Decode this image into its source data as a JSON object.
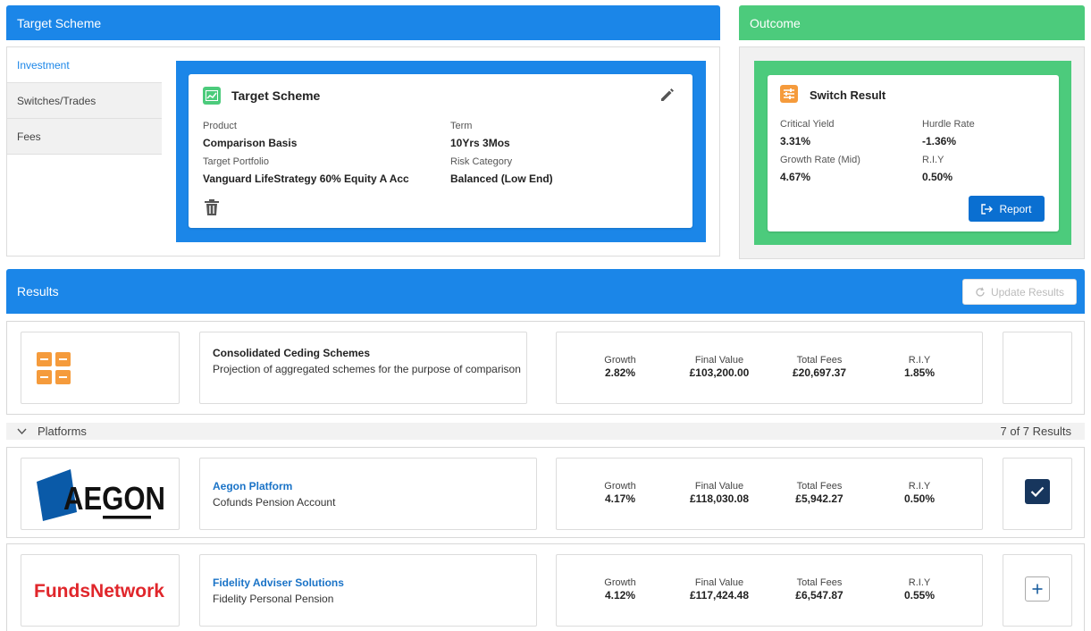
{
  "target_panel": {
    "header": "Target Scheme",
    "tabs": [
      {
        "label": "Investment",
        "active": true
      },
      {
        "label": "Switches/Trades",
        "active": false
      },
      {
        "label": "Fees",
        "active": false
      }
    ],
    "card": {
      "title": "Target Scheme",
      "fields": {
        "product_label": "Product",
        "product_value": "Comparison Basis",
        "term_label": "Term",
        "term_value": "10Yrs 3Mos",
        "portfolio_label": "Target Portfolio",
        "portfolio_value": "Vanguard LifeStrategy 60% Equity A Acc",
        "risk_label": "Risk Category",
        "risk_value": "Balanced (Low End)"
      }
    }
  },
  "outcome_panel": {
    "header": "Outcome",
    "card": {
      "title": "Switch Result",
      "critical_yield_label": "Critical Yield",
      "critical_yield_value": "3.31%",
      "hurdle_rate_label": "Hurdle Rate",
      "hurdle_rate_value": "-1.36%",
      "growth_rate_label": "Growth Rate (Mid)",
      "growth_rate_value": "4.67%",
      "riy_label": "R.I.Y",
      "riy_value": "0.50%",
      "report_button": "Report"
    }
  },
  "results": {
    "header": "Results",
    "update_button": "Update Results",
    "stat_labels": {
      "growth": "Growth",
      "final_value": "Final Value",
      "total_fees": "Total Fees",
      "riy": "R.I.Y"
    },
    "ceding": {
      "name": "Consolidated Ceding Schemes",
      "description": "Projection of aggregated schemes for the purpose of comparison",
      "growth": "2.82%",
      "final_value": "£103,200.00",
      "total_fees": "£20,697.37",
      "riy": "1.85%"
    },
    "platforms_label": "Platforms",
    "platforms_count": "7 of 7 Results",
    "platforms": [
      {
        "logo_text": "AEGON",
        "name": "Aegon Platform",
        "product": "Cofunds Pension Account",
        "growth": "4.17%",
        "final_value": "£118,030.08",
        "total_fees": "£5,942.27",
        "riy": "0.50%",
        "selected": true
      },
      {
        "logo_text": "FundsNetwork",
        "name": "Fidelity Adviser Solutions",
        "product": "Fidelity Personal Pension",
        "growth": "4.12%",
        "final_value": "£117,424.48",
        "total_fees": "£6,547.87",
        "riy": "0.55%",
        "selected": false
      }
    ]
  },
  "colors": {
    "primary_blue": "#1b86e8",
    "outcome_green": "#4ccb7c",
    "link_blue": "#1a73c7",
    "report_button": "#0a6fd1",
    "selected_check": "#17365d",
    "fidelity_red": "#e0262b",
    "ceding_orange": "#f59b3c"
  },
  "icons": {
    "edit": "pencil-icon",
    "delete": "trash-icon",
    "target_badge": "chart-icon",
    "outcome_badge": "sliders-icon",
    "report": "export-icon",
    "update": "refresh-icon",
    "ceding": "grid-icon",
    "collapse": "chevron-down-icon",
    "selected": "check-icon",
    "add": "plus-icon"
  }
}
